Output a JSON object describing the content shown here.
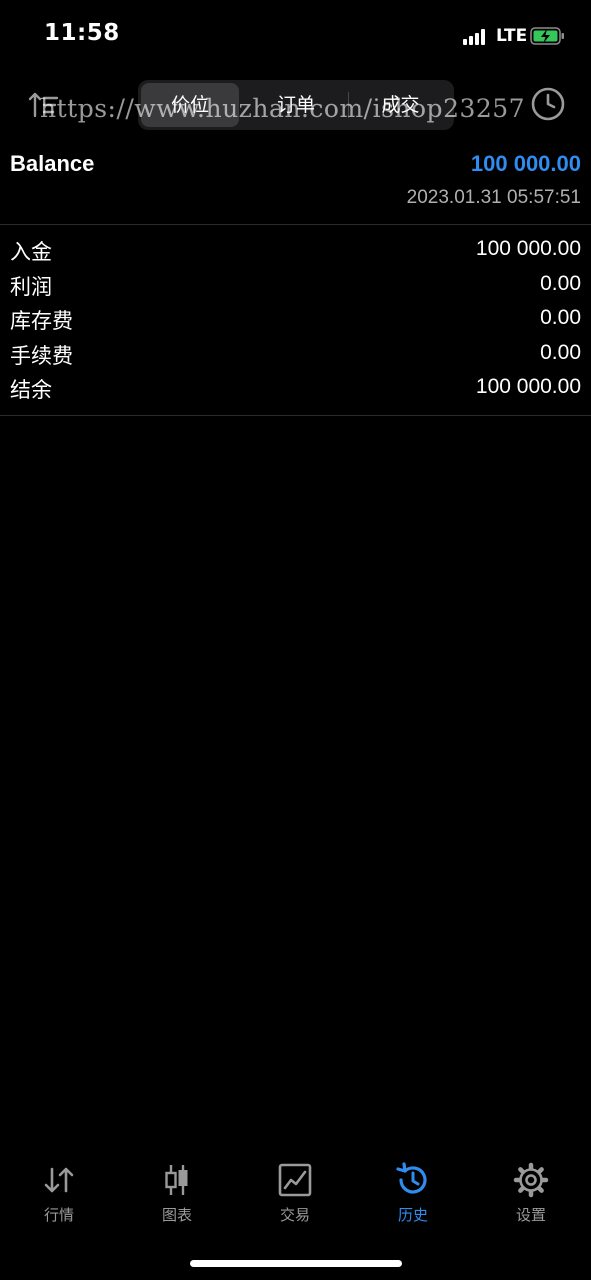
{
  "status_bar": {
    "time": "11:58",
    "network": "LTE"
  },
  "header": {
    "segments": [
      {
        "label": "价位"
      },
      {
        "label": "订单"
      },
      {
        "label": "成交"
      }
    ],
    "active_segment": 0
  },
  "watermark": "https://www.huzhan.com/ishop23257",
  "balance": {
    "label": "Balance",
    "value": "100 000.00",
    "timestamp": "2023.01.31 05:57:51"
  },
  "summary": [
    {
      "label": "入金",
      "value": "100 000.00"
    },
    {
      "label": "利润",
      "value": "0.00"
    },
    {
      "label": "库存费",
      "value": "0.00"
    },
    {
      "label": "手续费",
      "value": "0.00"
    },
    {
      "label": "结余",
      "value": "100 000.00"
    }
  ],
  "tabbar": {
    "items": [
      {
        "label": "行情",
        "icon": "quotes-arrows-icon"
      },
      {
        "label": "图表",
        "icon": "candlestick-icon"
      },
      {
        "label": "交易",
        "icon": "trade-chart-icon"
      },
      {
        "label": "历史",
        "icon": "history-clock-icon"
      },
      {
        "label": "设置",
        "icon": "gear-icon"
      }
    ],
    "active_index": 3
  },
  "colors": {
    "accent": "#2f8cf0",
    "background": "#000000"
  }
}
